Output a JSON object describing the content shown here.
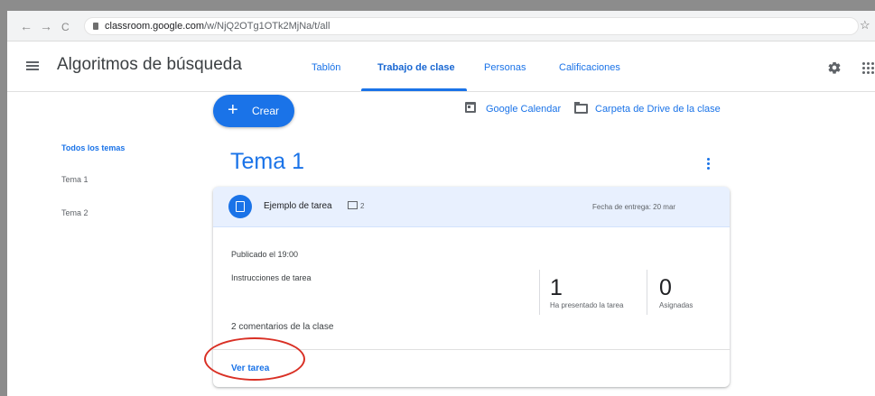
{
  "browser": {
    "back": "←",
    "forward": "→",
    "reload": "C",
    "url_host": "classroom.google.com",
    "url_path": "/w/NjQ2OTg1OTk2MjNa/t/all",
    "star": "☆"
  },
  "header": {
    "title": "Algoritmos de búsqueda",
    "tabs": [
      {
        "label": "Tablón"
      },
      {
        "label": "Trabajo de clase",
        "active": true
      },
      {
        "label": "Personas"
      },
      {
        "label": "Calificaciones"
      }
    ]
  },
  "toolbar": {
    "create_plus": "+",
    "create_label": "Crear",
    "calendar_label": "Google Calendar",
    "drive_label": "Carpeta de Drive de la clase"
  },
  "sidebar": {
    "items": [
      {
        "label": "Todos los temas",
        "active": true
      },
      {
        "label": "Tema 1"
      },
      {
        "label": "Tema 2"
      }
    ]
  },
  "topic": {
    "title": "Tema 1"
  },
  "assignment": {
    "title": "Ejemplo de tarea",
    "comment_count": "2",
    "due": "Fecha de entrega: 20 mar",
    "posted": "Publicado el 19:00",
    "instructions": "Instrucciones de tarea",
    "turned_in_count": "1",
    "turned_in_label": "Ha presentado la tarea",
    "assigned_count": "0",
    "assigned_label": "Asignadas",
    "class_comments": "2 comentarios de la clase",
    "view_label": "Ver tarea"
  },
  "colors": {
    "accent": "#1a73e8",
    "card_header": "#e8f0fe",
    "annotation": "#d93025"
  },
  "icons": [
    "menu-icon",
    "settings-gear-icon",
    "apps-grid-icon",
    "calendar-icon",
    "folder-icon",
    "assignment-icon",
    "comment-icon",
    "more-vert-icon",
    "lock-icon",
    "star-icon"
  ]
}
